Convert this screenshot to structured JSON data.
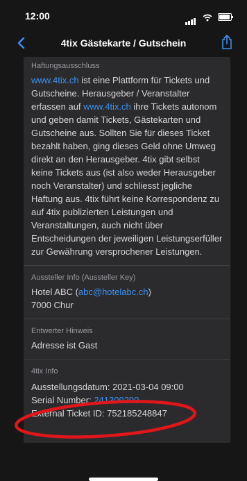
{
  "status_bar": {
    "time": "12:00",
    "signal_icon": "cellular-signal-icon",
    "wifi_icon": "wifi-icon",
    "battery_icon": "battery-icon"
  },
  "nav": {
    "title": "4tix Gästekarte / Gutschein",
    "back_icon": "chevron-left-icon",
    "share_icon": "share-icon",
    "accent_color": "#3d90f2"
  },
  "sections": {
    "haftung": {
      "title": "Haftungsausschluss",
      "link1": "www.4tix.ch",
      "text1": " ist eine Plattform für Tickets und Gutscheine. Herausgeber / Veranstalter erfassen auf ",
      "link2": "www.4tix.ch",
      "text2": " ihre Tickets autonom und geben damit Tickets, Gästekarten und Gutscheine aus. Sollten Sie für dieses Ticket bezahlt haben, ging dieses Geld ohne Umweg direkt an den Herausgeber. 4tix gibt selbst keine Tickets aus (ist also weder Herausgeber noch Veranstalter) und schliesst jegliche Haftung aus. 4tix führt keine Korrespondenz zu auf 4tix publizierten Leistungen und Veranstaltungen, auch nicht über Entscheidungen der jeweiligen Leistungserfüller zur Gewährung versprochener Leistungen."
    },
    "aussteller": {
      "title": "Aussteller Info (Aussteller Key)",
      "name": "Hotel ABC (",
      "email": "abc@hotelabc.ch",
      "name_close": ")",
      "city": "7000 Chur"
    },
    "entwerter": {
      "title": "Entwerter Hinweis",
      "text": "Adresse ist Gast"
    },
    "info": {
      "title": "4tix Info",
      "date_label": "Ausstellungsdatum: ",
      "date_value": "2021-03-04 09:00",
      "serial_label": "Serial Number: ",
      "serial_value": "241309290",
      "external_label": "External Ticket ID: ",
      "external_value": "752185248847"
    }
  },
  "annotation": {
    "shape": "ellipse",
    "color": "#e0161b"
  }
}
